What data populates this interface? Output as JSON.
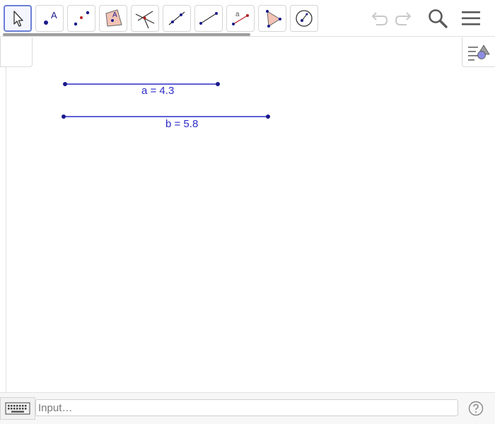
{
  "toolbar": {
    "tools": [
      {
        "name": "move-tool",
        "icon": "arrow-cursor-icon",
        "selected": true
      },
      {
        "name": "point-tool",
        "icon": "point-icon",
        "selected": false
      },
      {
        "name": "two-points-tool",
        "icon": "two-points-icon",
        "selected": false
      },
      {
        "name": "polygon-point-tool",
        "icon": "point-on-object-icon",
        "selected": false
      },
      {
        "name": "intersect-tool",
        "icon": "intersect-icon",
        "selected": false
      },
      {
        "name": "line-tool",
        "icon": "line-icon",
        "selected": false
      },
      {
        "name": "segment-tool",
        "icon": "segment-icon",
        "selected": false
      },
      {
        "name": "segment-length-tool",
        "icon": "segment-fixed-length-icon",
        "selected": false
      },
      {
        "name": "polygon-tool",
        "icon": "polygon-icon",
        "selected": false
      },
      {
        "name": "circle-tool",
        "icon": "circle-icon",
        "selected": false
      }
    ],
    "tool_point_label": "A",
    "tool_polygon_point_label": "A",
    "tool_segment_length_label": "a",
    "right": {
      "undo_icon": "undo-icon",
      "redo_icon": "redo-icon",
      "search_icon": "search-icon",
      "menu_icon": "hamburger-menu-icon"
    }
  },
  "graphics": {
    "segments": [
      {
        "name": "a",
        "label": "a = 4.3",
        "length": 4.3
      },
      {
        "name": "b",
        "label": "b = 5.8",
        "length": 5.8
      }
    ],
    "style_bar_icon": "style-bar-toggle-icon"
  },
  "inputbar": {
    "keyboard_icon": "keyboard-icon",
    "placeholder": "Input…",
    "help_icon": "help-icon"
  },
  "colors": {
    "segment": "#2c2cc8",
    "point": "#1a1a8c",
    "selected_tool_border": "#6b7fd7"
  }
}
